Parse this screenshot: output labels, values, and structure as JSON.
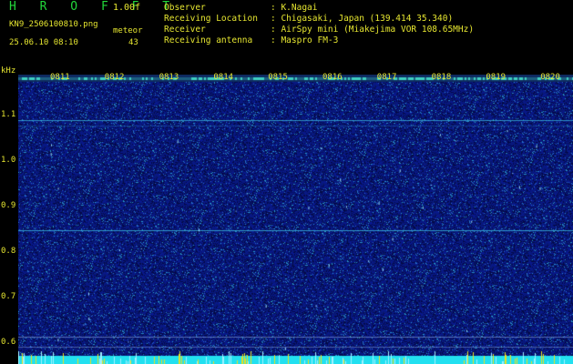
{
  "header": {
    "brand": "H R O F F T",
    "version": "1.00f",
    "filename": "KN9_2506100810.png",
    "datetime": "25.06.10 08:10",
    "meteor_label": "meteor",
    "meteor_count": "43"
  },
  "info": [
    {
      "label": "Observer",
      "value": ": K.Nagai"
    },
    {
      "label": "Receiving Location",
      "value": ": Chigasaki, Japan (139.414 35.340)"
    },
    {
      "label": "Receiver",
      "value": ": AirSpy mini (Miakejima VOR 108.65MHz)"
    },
    {
      "label": "Receiving antenna",
      "value": ": Maspro FM-3"
    }
  ],
  "axis": {
    "unit": "kHz",
    "y_ticks": [
      "1.1",
      "1.0",
      "0.9",
      "0.8",
      "0.7",
      "0.6"
    ],
    "x_ticks": [
      "0811",
      "0812",
      "0813",
      "0814",
      "0815",
      "0816",
      "0817",
      "0818",
      "0819",
      "0820"
    ]
  },
  "colors": {
    "background": "#000000",
    "spectrogram_base": "#0a1a7a",
    "label_text": "#e6e630",
    "brand_text": "#22d63a",
    "carrier_line": "#3ab8e0",
    "noise_band": "#22e0f0"
  }
}
